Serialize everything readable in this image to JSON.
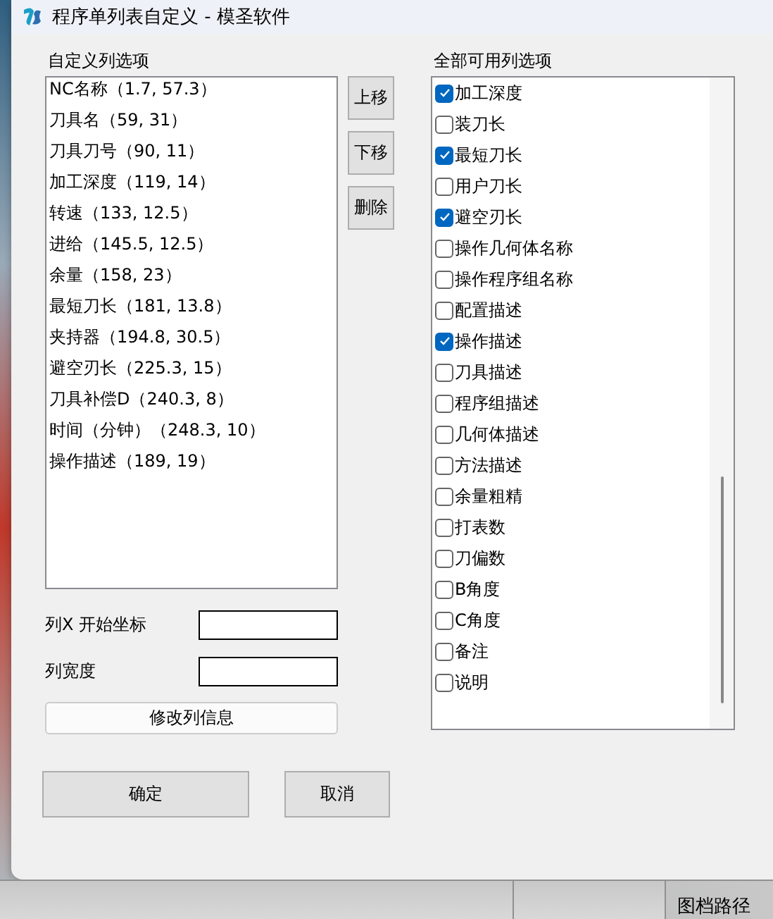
{
  "window": {
    "title": "程序单列表自定义 - 模圣软件"
  },
  "custom_columns": {
    "label": "自定义列选项",
    "items": [
      {
        "text": "NC名称（1.7, 57.3）"
      },
      {
        "text": "刀具名（59, 31）"
      },
      {
        "text": "刀具刀号（90, 11）"
      },
      {
        "text": "加工深度（119, 14）"
      },
      {
        "text": "转速（133, 12.5）"
      },
      {
        "text": "进给（145.5, 12.5）"
      },
      {
        "text": "余量（158, 23）"
      },
      {
        "text": "最短刀长（181, 13.8）"
      },
      {
        "text": "夹持器（194.8, 30.5）"
      },
      {
        "text": "避空刃长（225.3, 15）"
      },
      {
        "text": "刀具补偿D（240.3, 8）"
      },
      {
        "text": "时间（分钟）（248.3, 10）"
      },
      {
        "text": "操作描述（189, 19）"
      }
    ]
  },
  "move_buttons": [
    "上移",
    "下移",
    "删除"
  ],
  "available_columns": {
    "label": "全部可用列选项",
    "items": [
      {
        "text": "加工深度",
        "checked": true
      },
      {
        "text": "装刀长",
        "checked": false
      },
      {
        "text": "最短刀长",
        "checked": true
      },
      {
        "text": "用户刀长",
        "checked": false
      },
      {
        "text": "避空刃长",
        "checked": true
      },
      {
        "text": "操作几何体名称",
        "checked": false
      },
      {
        "text": "操作程序组名称",
        "checked": false
      },
      {
        "text": "配置描述",
        "checked": false
      },
      {
        "text": "操作描述",
        "checked": true
      },
      {
        "text": "刀具描述",
        "checked": false
      },
      {
        "text": "程序组描述",
        "checked": false
      },
      {
        "text": "几何体描述",
        "checked": false
      },
      {
        "text": "方法描述",
        "checked": false
      },
      {
        "text": "余量粗精",
        "checked": false
      },
      {
        "text": "打表数",
        "checked": false
      },
      {
        "text": "刀偏数",
        "checked": false
      },
      {
        "text": "B角度",
        "checked": false
      },
      {
        "text": "C角度",
        "checked": false
      },
      {
        "text": "备注",
        "checked": false
      },
      {
        "text": "说明",
        "checked": false
      }
    ]
  },
  "fields": [
    {
      "label": "列X 开始坐标"
    },
    {
      "label": "列宽度"
    }
  ],
  "modify_button": "修改列信息",
  "ok_button": "确定",
  "cancel_button": "取消",
  "background": {
    "column_header": "图档路径"
  }
}
